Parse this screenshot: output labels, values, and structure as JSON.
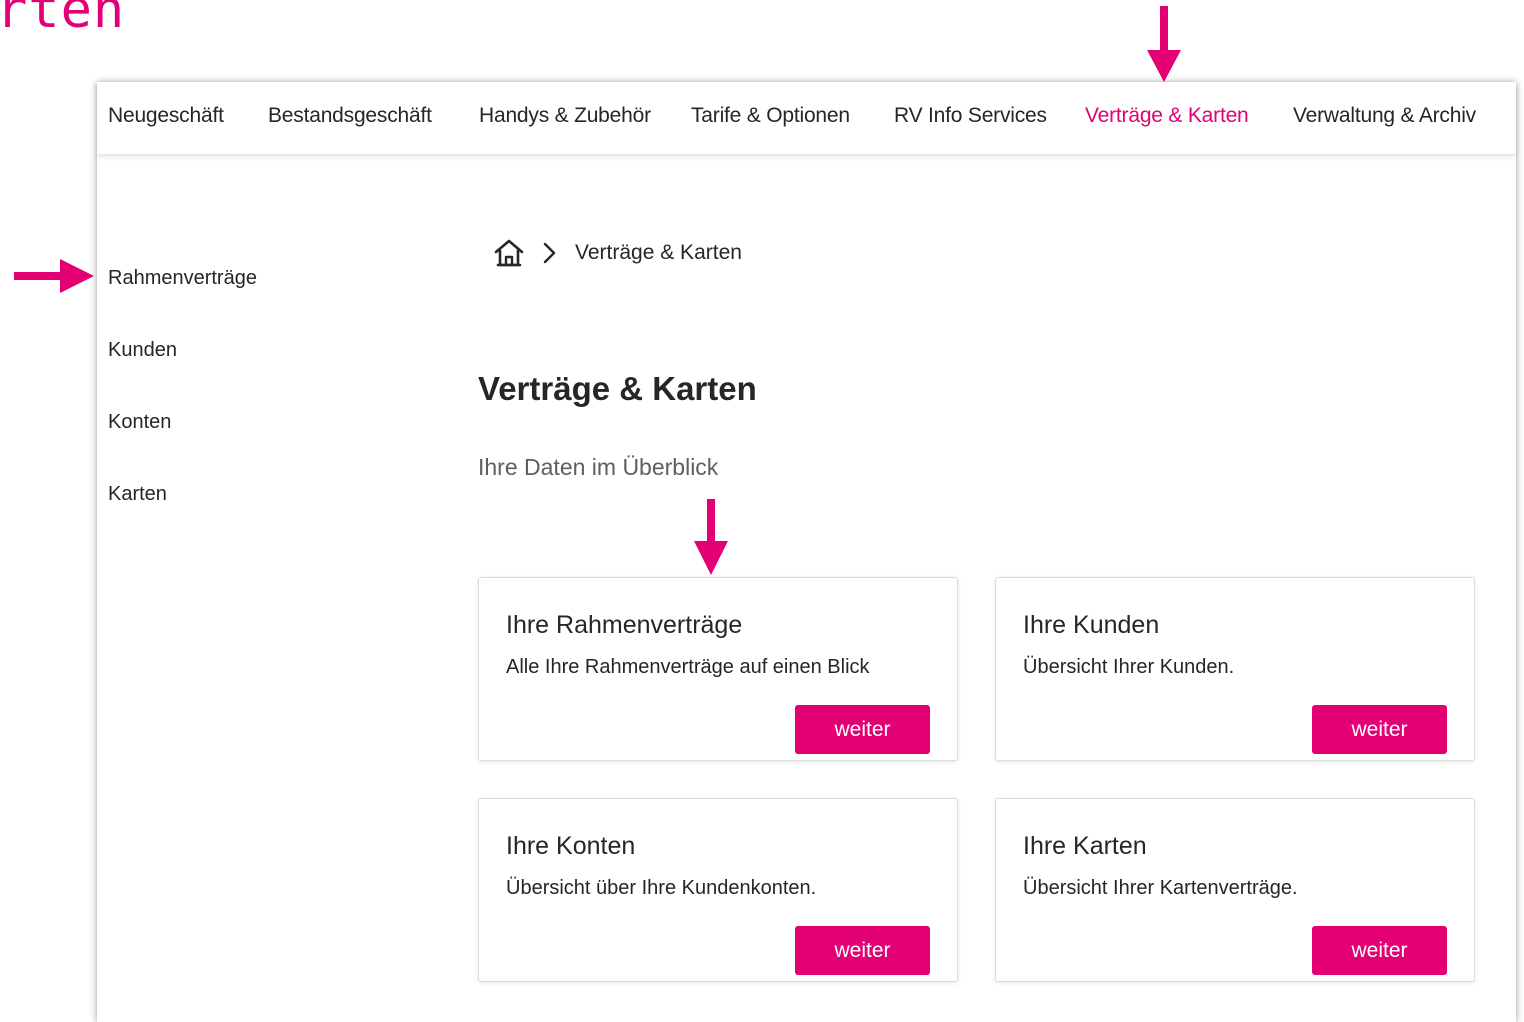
{
  "slide": {
    "title_fragment": "rten"
  },
  "topnav": {
    "items": [
      {
        "label": "Neugeschäft"
      },
      {
        "label": "Bestandsgeschäft"
      },
      {
        "label": "Handys & Zubehör"
      },
      {
        "label": "Tarife & Optionen"
      },
      {
        "label": "RV Info Services"
      },
      {
        "label": "Verträge & Karten",
        "active": true
      },
      {
        "label": "Verwaltung & Archiv"
      }
    ]
  },
  "sidebar": {
    "items": [
      {
        "label": "Rahmenverträge"
      },
      {
        "label": "Kunden"
      },
      {
        "label": "Konten"
      },
      {
        "label": "Karten"
      }
    ]
  },
  "breadcrumb": {
    "current": "Verträge & Karten",
    "home_icon": "home-icon",
    "separator_icon": "chevron-right-icon"
  },
  "main": {
    "title": "Verträge & Karten",
    "subtitle": "Ihre Daten im Überblick",
    "cards": [
      {
        "title": "Ihre Rahmenverträge",
        "text": "Alle Ihre Rahmenverträge auf einen Blick",
        "button": "weiter"
      },
      {
        "title": "Ihre Kunden",
        "text": "Übersicht Ihrer Kunden.",
        "button": "weiter"
      },
      {
        "title": "Ihre Konten",
        "text": "Übersicht über Ihre Kundenkonten.",
        "button": "weiter"
      },
      {
        "title": "Ihre Karten",
        "text": "Übersicht Ihrer Kartenverträge.",
        "button": "weiter"
      }
    ]
  },
  "colors": {
    "accent": "#e20074",
    "text": "#262626",
    "muted": "#5f5f5f",
    "border": "#dcdcdc"
  },
  "annotations": {
    "arrow_icon": "arrow-icon"
  }
}
